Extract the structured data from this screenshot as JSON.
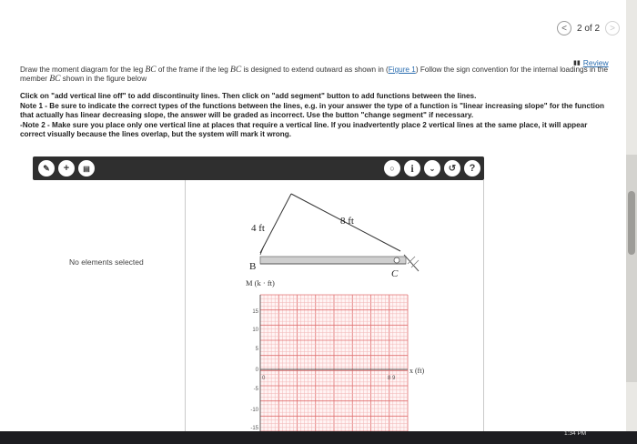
{
  "pager": {
    "text": "2 of 2",
    "prev": "<",
    "next": ">"
  },
  "review": {
    "label": "Review"
  },
  "intro": {
    "p1": "Draw the moment diagram for the leg ",
    "bc1": "BC",
    "p2": " of the frame if the leg ",
    "bc2": "BC",
    "p3": " is designed to extend outward as shown in (",
    "figure_link": "Figure 1",
    "p4": ") Follow the sign convention for the internal loadings in the member ",
    "bc3": "BC",
    "p5": " shown in the figure below"
  },
  "instructions": {
    "line1": "Click on \"add vertical line off\" to add discontinuity lines. Then click on \"add segment\" button to add functions between the lines.",
    "line2": "Note 1 - Be sure to indicate the correct types of the functions between the lines, e.g. in your answer the type of a function is \"linear increasing slope\" for the function that actually has linear decreasing slope, the answer will be graded as incorrect. Use the button \"change segment\" if necessary.",
    "line3": "-Note 2 - Make sure you place only one vertical line at places that require a vertical line. If you inadvertently place 2 vertical lines at the same place, it will appear correct visually because the lines overlap, but the system will mark it wrong."
  },
  "toolbar": {
    "left_buttons": [
      "edit-icon",
      "plus-icon",
      "trash-icon"
    ],
    "right_buttons": [
      "bulb-icon",
      "info-icon",
      "chevron-down-icon",
      "undo-icon",
      "help-icon"
    ],
    "help_label": "?",
    "info_label": "i",
    "plus_label": "+"
  },
  "left_panel": {
    "status": "No elements selected"
  },
  "figure": {
    "label_4ft": "4 ft",
    "label_8ft": "8 ft",
    "label_B": "B",
    "label_C": "C",
    "y_axis_label": "M (k · ft)",
    "x_axis_label": "x (ft)",
    "y_ticks": [
      "15",
      "10",
      "5",
      "0",
      "-5",
      "-10",
      "-15"
    ],
    "x_ticks": [
      "0",
      "8"
    ],
    "x_end_tick": "8 9"
  },
  "taskbar": {
    "time": "1:34 PM"
  }
}
